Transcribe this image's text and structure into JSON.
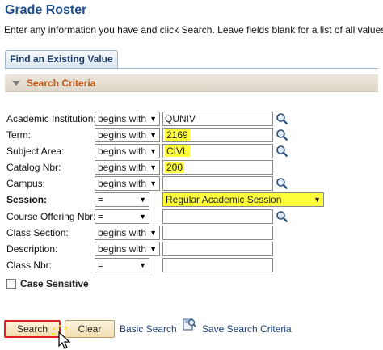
{
  "page": {
    "title": "Grade Roster",
    "instructions": "Enter any information you have and click Search. Leave fields blank for a list of all values."
  },
  "tabs": [
    {
      "label": "Find an Existing Value",
      "active": true
    }
  ],
  "section": {
    "title": "Search Criteria"
  },
  "fields": [
    {
      "label": "Academic Institution:",
      "operator": "begins with",
      "value": "QUNIV",
      "highlighted": false,
      "lookup": true
    },
    {
      "label": "Term:",
      "operator": "begins with",
      "value": "2169",
      "highlighted": true,
      "lookup": true
    },
    {
      "label": "Subject Area:",
      "operator": "begins with",
      "value": "CIVL",
      "highlighted": true,
      "lookup": true
    },
    {
      "label": "Catalog Nbr:",
      "operator": "begins with",
      "value": "200",
      "highlighted": true,
      "lookup": false
    },
    {
      "label": "Campus:",
      "operator": "begins with",
      "value": "",
      "highlighted": false,
      "lookup": true
    },
    {
      "label": "Session:",
      "operator": "=",
      "value": "Regular Academic Session",
      "highlighted": true,
      "lookup": false
    },
    {
      "label": "Course Offering Nbr:",
      "operator": "=",
      "value": "",
      "highlighted": false,
      "lookup": true
    },
    {
      "label": "Class Section:",
      "operator": "begins with",
      "value": "",
      "highlighted": false,
      "lookup": false
    },
    {
      "label": "Description:",
      "operator": "begins with",
      "value": "",
      "highlighted": false,
      "lookup": false
    },
    {
      "label": "Class Nbr:",
      "operator": "=",
      "value": "",
      "highlighted": false,
      "lookup": false
    }
  ],
  "case_sensitive": {
    "label": "Case Sensitive",
    "checked": false
  },
  "buttons": {
    "search": "Search",
    "clear": "Clear"
  },
  "links": {
    "basic_search": "Basic Search",
    "save_search": "Save Search Criteria"
  },
  "colors": {
    "highlight": "#ffff3a",
    "title": "#1f4e8c",
    "section_title": "#c05a16",
    "search_outline": "#e02020"
  }
}
